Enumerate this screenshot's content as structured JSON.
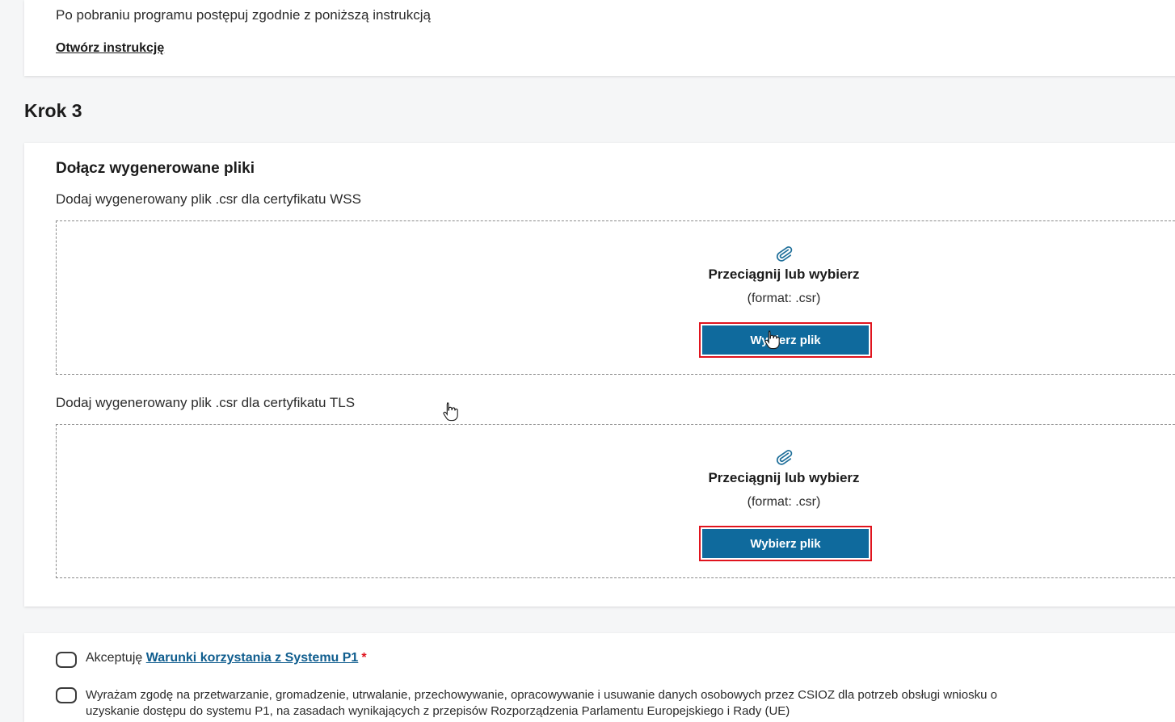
{
  "step2": {
    "instruction_text": "Po pobraniu programu postępuj zgodnie z poniższą instrukcją",
    "open_instructions_link": "Otwórz instrukcję"
  },
  "step3": {
    "title": "Krok 3",
    "section_title": "Dołącz wygenerowane pliki",
    "wss": {
      "label": "Dodaj wygenerowany plik .csr dla certyfikatu WSS",
      "drop_title": "Przeciągnij lub wybierz",
      "format": "(format: .csr)",
      "button": "Wybierz plik"
    },
    "tls": {
      "label": "Dodaj wygenerowany plik .csr dla certyfikatu TLS",
      "drop_title": "Przeciągnij lub wybierz",
      "format": "(format: .csr)",
      "button": "Wybierz plik"
    }
  },
  "consents": {
    "terms_prefix": "Akceptuję ",
    "terms_link": "Warunki korzystania z Systemu P1",
    "required_marker": "*",
    "gdpr_text": "Wyrażam zgodę na przetwarzanie, gromadzenie, utrwalanie, przechowywanie, opracowywanie i usuwanie danych osobowych przez CSIOZ dla potrzeb obsługi wniosku o uzyskanie dostępu do systemu P1, na zasadach wynikających z przepisów Rozporządzenia Parlamentu Europejskiego i Rady (UE)"
  },
  "icons": {
    "attach": "paperclip-icon",
    "cursor": "hand-pointer-icon"
  },
  "colors": {
    "primary_button": "#0f6a9d",
    "highlight_outline": "#e0141e",
    "link": "#0f5d8e"
  }
}
